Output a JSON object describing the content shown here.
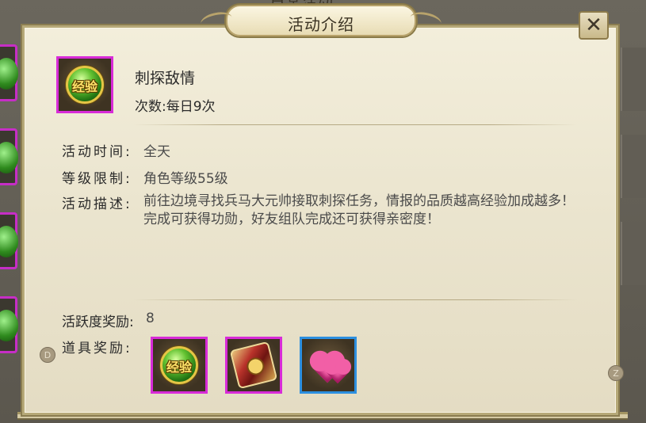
{
  "background": {
    "title": "日常活动"
  },
  "dialog": {
    "title": "活动介绍",
    "close_label": "✕"
  },
  "activity": {
    "icon_text": "经验",
    "name": "刺探敌情",
    "count": "次数:每日9次"
  },
  "details": {
    "time_label": "活动时间:",
    "time_value": "全天",
    "level_label": "等级限制:",
    "level_value": "角色等级55级",
    "desc_label": "活动描述:",
    "desc_value": "前往边境寻找兵马大元帅接取刺探任务，情报的品质越高经验加成越多！完成可获得功勋，好友组队完成还可获得亲密度！"
  },
  "rewards": {
    "activity_label": "活跃度奖励:",
    "activity_value": "8",
    "items_label": "道具奖励:",
    "items": [
      {
        "icon": "exp-orb-icon",
        "text": "经验",
        "rarity": "purple"
      },
      {
        "icon": "scroll-badge-icon",
        "text": "",
        "rarity": "purple"
      },
      {
        "icon": "pink-hearts-icon",
        "text": "",
        "rarity": "blue"
      }
    ]
  },
  "badges": {
    "left": "D",
    "right": "Z"
  },
  "colors": {
    "purple_border": "#d82bd8",
    "blue_border": "#2c8fe0",
    "panel_bg": "#ebe5cf"
  }
}
